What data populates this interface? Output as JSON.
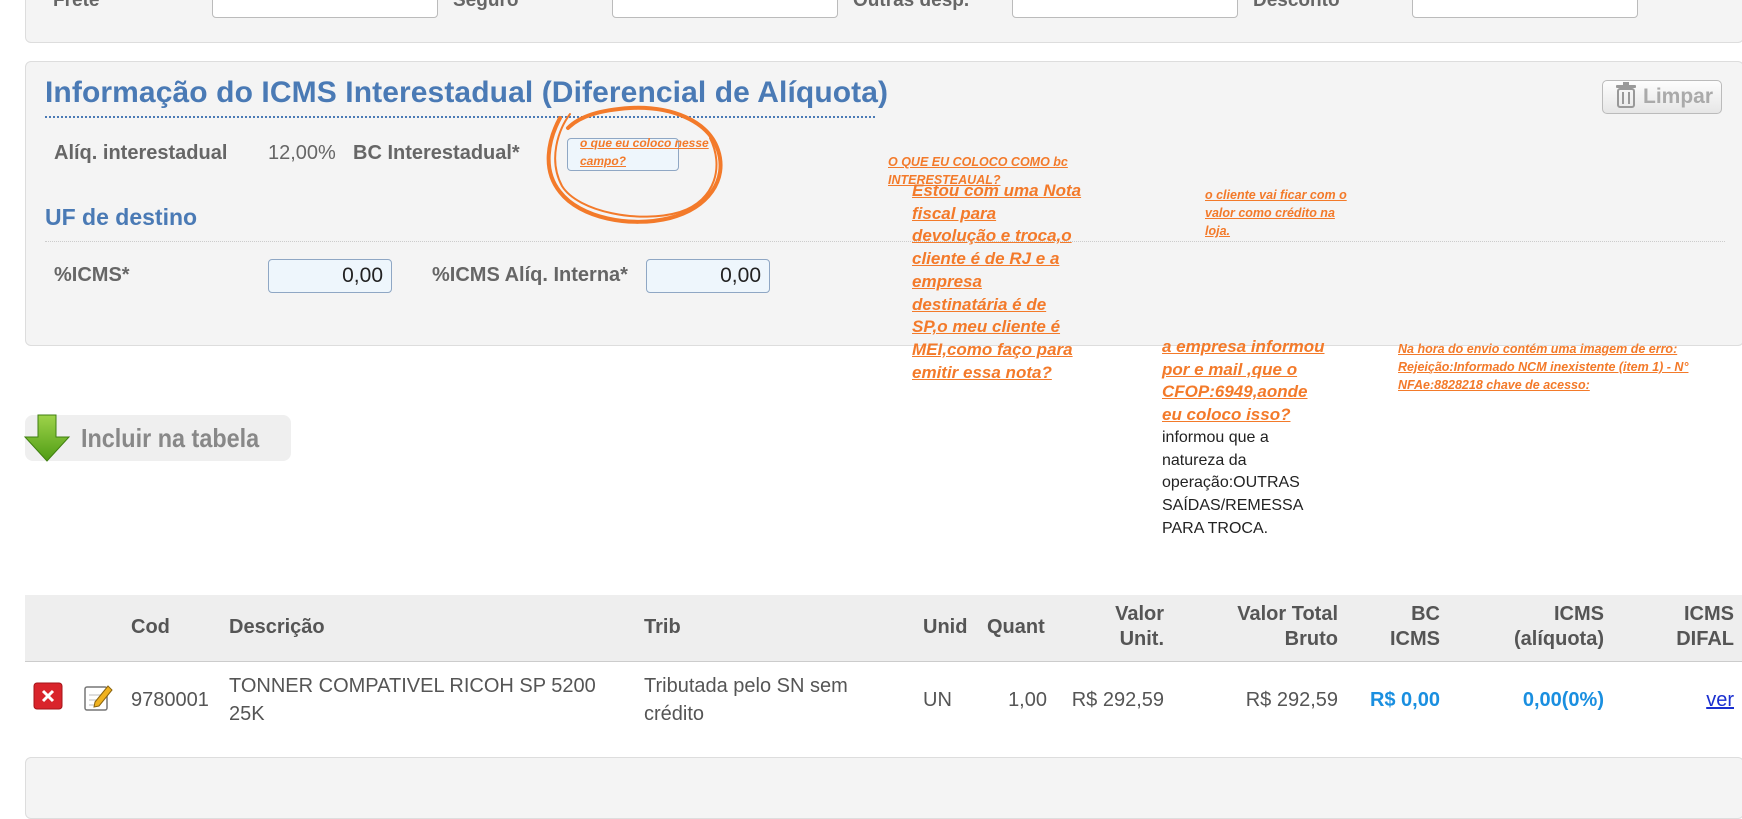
{
  "top_row": {
    "frete_label": "Frete",
    "seguro_label": "Seguro",
    "outras_label": "Outras desp.",
    "desconto_label": "Desconto"
  },
  "icms": {
    "title": "Informação do ICMS Interestadual (Diferencial de Alíquota)",
    "limpar_label": "Limpar",
    "aliq_label": "Alíq. interestadual",
    "aliq_value": "12,00%",
    "bc_label": "BC Interestadual*",
    "uf_title": "UF de destino",
    "picms_label": "%ICMS*",
    "picms_value": "0,00",
    "picms_interna_label": "%ICMS Alíq. Interna*",
    "picms_interna_value": "0,00"
  },
  "annotations": {
    "circle_note": "o que eu coloco nesse campo?",
    "bc_question": "O QUE EU COLOCO COMO bc INTERESTEAUAL?",
    "main_question": "Estou com uma Nota fiscal para devolução e troca,o cliente é de RJ e a empresa destinatária é de SP,o meu cliente é MEI,como faço para emitir essa nota?",
    "credit_note": "o cliente vai ficar com o valor como crédito na loja.",
    "cfop_note": "a empresa informou por e mail ,que o CFOP:6949,aonde eu coloco isso?",
    "natureza_note": "informou que a natureza da operação:OUTRAS SAÍDAS/REMESSA PARA TROCA.",
    "error_note": "Na hora do envio contém uma imagem de erro: Rejeição:Informado NCM inexistente (item 1) - N° NFAe:8828218 chave de acesso:"
  },
  "incluir_label": "Incluir na tabela",
  "table": {
    "headers": {
      "cod": "Cod",
      "descricao": "Descrição",
      "trib": "Trib",
      "unid": "Unid",
      "quant": "Quant",
      "valor_unit_1": "Valor",
      "valor_unit_2": "Unit.",
      "valor_total_1": "Valor Total",
      "valor_total_2": "Bruto",
      "bc_icms_1": "BC",
      "bc_icms_2": "ICMS",
      "icms_aliq_1": "ICMS",
      "icms_aliq_2": "(alíquota)",
      "icms_difal_1": "ICMS",
      "icms_difal_2": "DIFAL"
    },
    "rows": [
      {
        "cod": "9780001",
        "descricao_1": "TONNER COMPATIVEL RICOH SP 5200",
        "descricao_2": "25K",
        "trib_1": "Tributada pelo SN sem",
        "trib_2": "crédito",
        "unid": "UN",
        "quant": "1,00",
        "valor_unit": "R$ 292,59",
        "valor_total": "R$ 292,59",
        "bc_icms": "R$ 0,00",
        "icms_aliq": "0,00(0%)",
        "icms_difal": "ver"
      }
    ]
  },
  "colors": {
    "title_blue": "#4a7ab5",
    "annotation_orange": "#f37a2a",
    "link_blue": "#1a8fe0"
  }
}
